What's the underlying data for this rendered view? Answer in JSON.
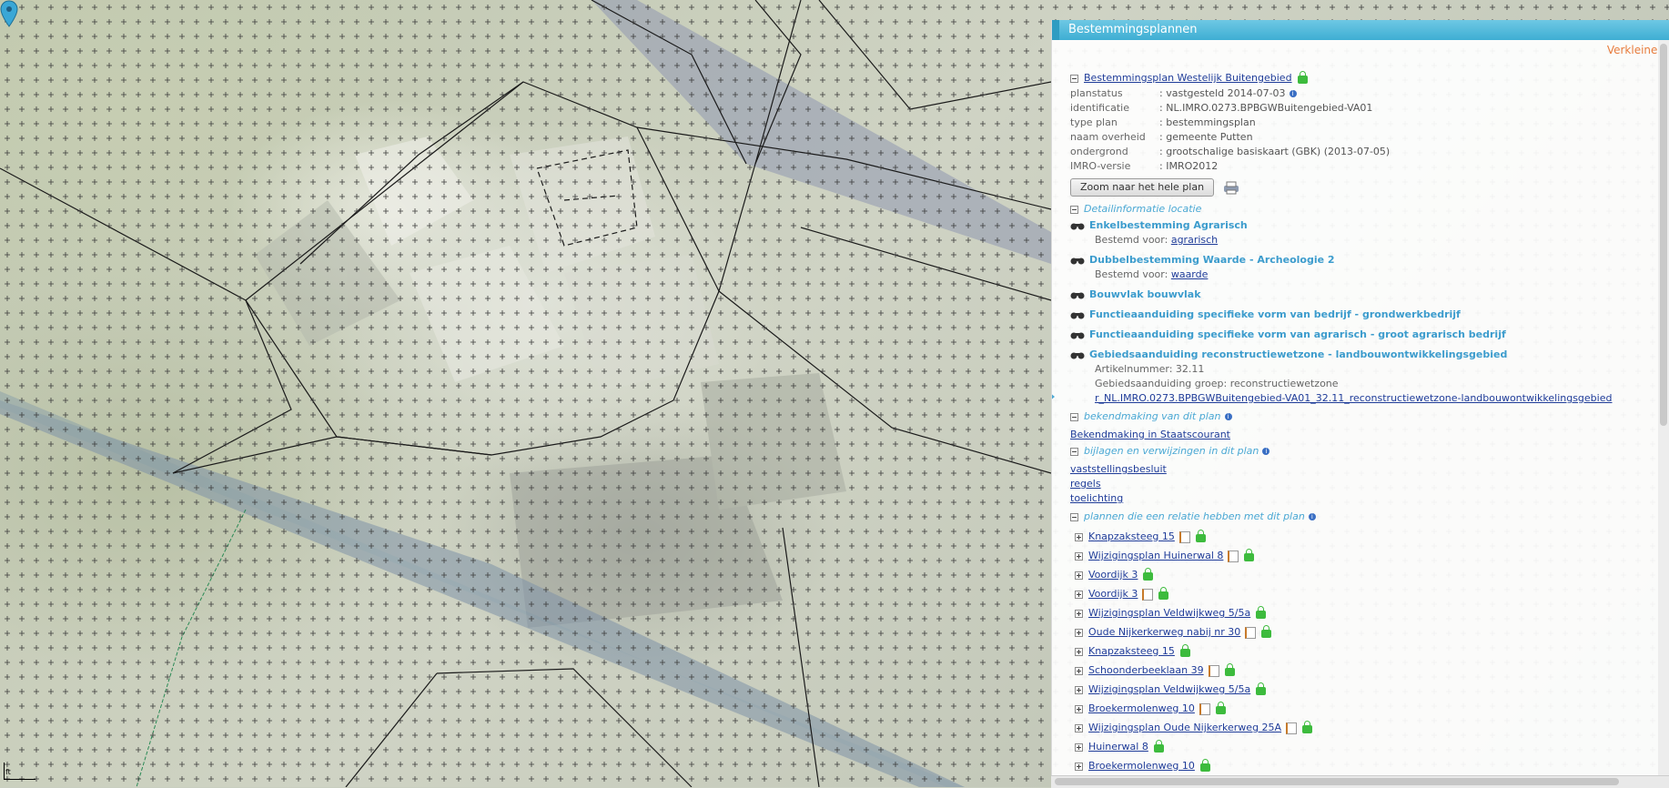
{
  "panel": {
    "title": "Bestemmingsplannen",
    "collapse_label": "Verkleinen",
    "plan_title": "Bestemmingsplan Westelijk Buitengebied",
    "info": [
      {
        "key": "planstatus",
        "sep": ":",
        "value": "vastgesteld 2014-07-03",
        "has_info": true
      },
      {
        "key": "identificatie",
        "sep": ":",
        "value": "NL.IMRO.0273.BPBGWBuitengebied-VA01",
        "has_info": false
      },
      {
        "key": "type plan",
        "sep": ":",
        "value": "bestemmingsplan",
        "has_info": false
      },
      {
        "key": "naam overheid",
        "sep": ":",
        "value": "gemeente Putten",
        "has_info": false
      },
      {
        "key": "ondergrond",
        "sep": ":",
        "value": "grootschalige basiskaart (GBK) (2013-07-05)",
        "has_info": false
      },
      {
        "key": "IMRO-versie",
        "sep": ":",
        "value": "IMRO2012",
        "has_info": false
      }
    ],
    "zoom_button": "Zoom naar het hele plan",
    "detail_section": "Detailinformatie locatie",
    "features": [
      {
        "title": "Enkelbestemming Agrarisch",
        "label": "Bestemd voor:",
        "link": "agrarisch"
      },
      {
        "title": "Dubbelbestemming Waarde - Archeologie 2",
        "label": "Bestemd voor:",
        "link": "waarde"
      },
      {
        "title": "Bouwvlak bouwvlak"
      },
      {
        "title": "Functieaanduiding specifieke vorm van bedrijf - grondwerkbedrijf"
      },
      {
        "title": "Functieaanduiding specifieke vorm van agrarisch - groot agrarisch bedrijf"
      },
      {
        "title": "Gebiedsaanduiding reconstructiewetzone - landbouwontwikkelingsgebied",
        "article": "Artikelnummer: 32.11",
        "group": "Gebiedsaanduiding groep: reconstructiewetzone",
        "doc_link": "r_NL.IMRO.0273.BPBGWBuitengebied-VA01_32.11_reconstructiewetzone-landbouwontwikkelingsgebied"
      }
    ],
    "bekendmaking_section": "bekendmaking van dit plan",
    "bekendmaking_link": "Bekendmaking in Staatscourant",
    "bijlagen_section": "bijlagen en verwijzingen in dit plan",
    "bijlagen_links": [
      "vaststellingsbesluit",
      "regels",
      "toelichting"
    ],
    "relations_section": "plannen die een relatie hebben met dit plan",
    "related_plans": [
      {
        "name": "Knapzaksteeg 15",
        "doc": true
      },
      {
        "name": "Wijzigingsplan Huinerwal 8",
        "doc": true
      },
      {
        "name": "Voordijk 3",
        "doc": false
      },
      {
        "name": "Voordijk 3",
        "doc": true
      },
      {
        "name": "Wijzigingsplan Veldwijkweg 5/5a",
        "doc": false
      },
      {
        "name": "Oude Nijkerkerweg nabij nr 30",
        "doc": true
      },
      {
        "name": "Knapzaksteeg 15",
        "doc": false
      },
      {
        "name": "Schoonderbeeklaan 39",
        "doc": true
      },
      {
        "name": "Wijzigingsplan Veldwijkweg 5/5a",
        "doc": false
      },
      {
        "name": "Broekermolenweg 10",
        "doc": true
      },
      {
        "name": "Wijzigingsplan Oude Nijkerkerweg 25A",
        "doc": true
      },
      {
        "name": "Huinerwal 8",
        "doc": false
      },
      {
        "name": "Broekermolenweg 10",
        "doc": false
      }
    ]
  },
  "map": {
    "scale_label": "ft",
    "colors": {
      "road": "#8a9bb0",
      "pin": "#3aa7d6",
      "grid_marker": "#333333"
    }
  }
}
